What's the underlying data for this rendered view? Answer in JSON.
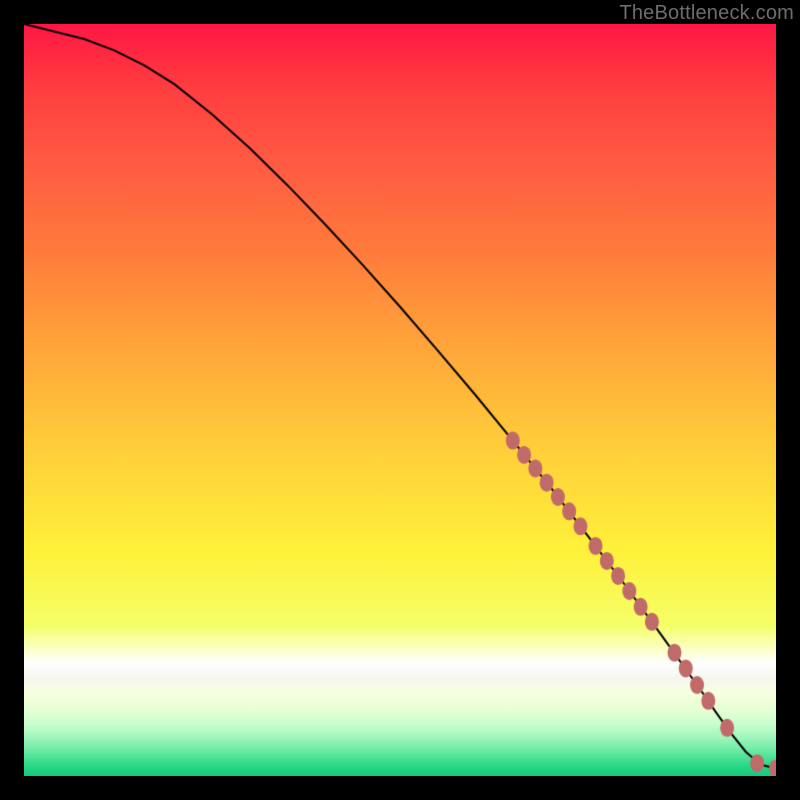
{
  "watermark_text": "TheBottleneck.com",
  "colors": {
    "curve": "#000000",
    "marker_fill": "#c06a6a",
    "marker_stroke": "#c06a6a"
  },
  "chart_data": {
    "type": "line",
    "title": "",
    "xlabel": "",
    "ylabel": "",
    "xlim": [
      0,
      100
    ],
    "ylim": [
      0,
      100
    ],
    "series": [
      {
        "name": "curve",
        "x": [
          0,
          4,
          8,
          12,
          16,
          20,
          25,
          30,
          35,
          40,
          45,
          50,
          55,
          60,
          65,
          70,
          75,
          80,
          85,
          90,
          92,
          94,
          96,
          98,
          100
        ],
        "values": [
          100,
          99,
          98,
          96.5,
          94.5,
          92,
          88,
          83.5,
          78.6,
          73.4,
          68.0,
          62.4,
          56.6,
          50.7,
          44.6,
          38.4,
          31.9,
          25.3,
          18.4,
          11.4,
          8.5,
          5.7,
          3.2,
          1.5,
          1.0
        ]
      }
    ],
    "markers": {
      "name": "highlight-points",
      "x": [
        65.0,
        66.5,
        68.0,
        69.5,
        71.0,
        72.5,
        74.0,
        76.0,
        77.5,
        79.0,
        80.5,
        82.0,
        83.5,
        86.5,
        88.0,
        89.5,
        91.0,
        93.5,
        97.5,
        100.0
      ],
      "values": [
        44.6,
        42.7,
        40.9,
        39.0,
        37.1,
        35.2,
        33.2,
        30.6,
        28.6,
        26.6,
        24.6,
        22.5,
        20.5,
        16.4,
        14.3,
        12.1,
        10.0,
        6.4,
        1.7,
        1.0
      ]
    }
  }
}
